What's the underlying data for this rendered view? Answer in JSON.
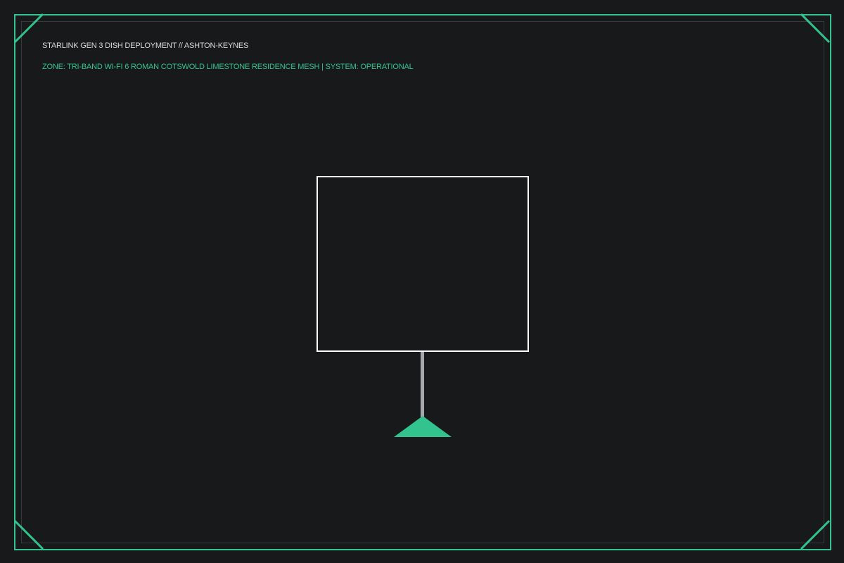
{
  "header": {
    "title": "STARLINK GEN 3 DISH DEPLOYMENT // ASHTON-KEYNES",
    "zone_status": "ZONE: TRI-BAND WI-FI 6 ROMAN COTSWOLD LIMESTONE RESIDENCE MESH | SYSTEM: OPERATIONAL"
  },
  "colors": {
    "background": "#18191b",
    "accent": "#33c38e",
    "dish_outline": "#ffffff",
    "mast": "#a7a8ab",
    "title_text": "#d9dadc"
  },
  "icons": {
    "dish": "starlink-dish-icon",
    "mast": "dish-mast-icon",
    "base": "mount-base-triangle-icon"
  }
}
